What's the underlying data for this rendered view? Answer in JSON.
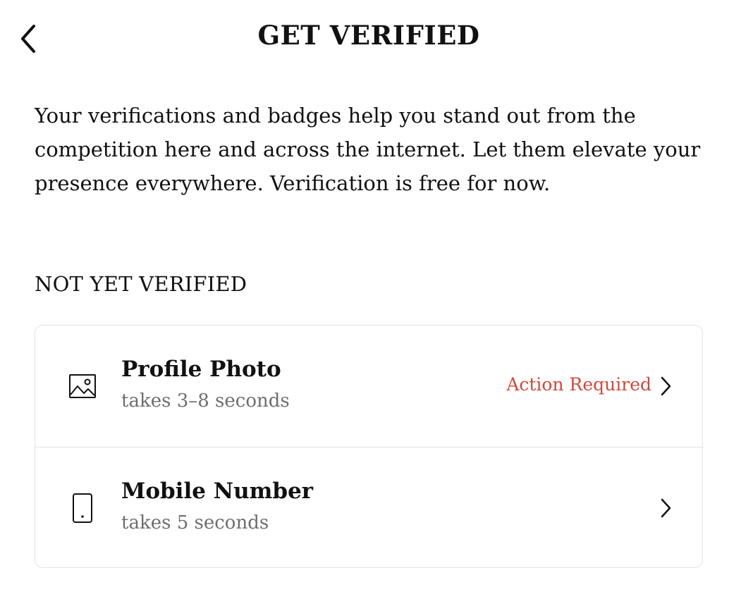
{
  "header": {
    "title": "GET VERIFIED",
    "back_icon": "chevron-left-icon"
  },
  "intro": {
    "text": "Your verifications and badges help you stand out from the competition here and across the internet. Let them elevate your presence everywhere. Verification is free for now."
  },
  "section": {
    "label": "NOT YET VERIFIED"
  },
  "items": [
    {
      "icon": "image-icon",
      "title": "Profile Photo",
      "subtitle": "takes 3–8 seconds",
      "status": "Action Required"
    },
    {
      "icon": "mobile-phone-icon",
      "title": "Mobile Number",
      "subtitle": "takes 5 seconds",
      "status": ""
    }
  ],
  "colors": {
    "status_accent": "#d0483b",
    "subtitle_gray": "#6e6e6e",
    "border": "#e3e3e3",
    "text": "#111111"
  }
}
